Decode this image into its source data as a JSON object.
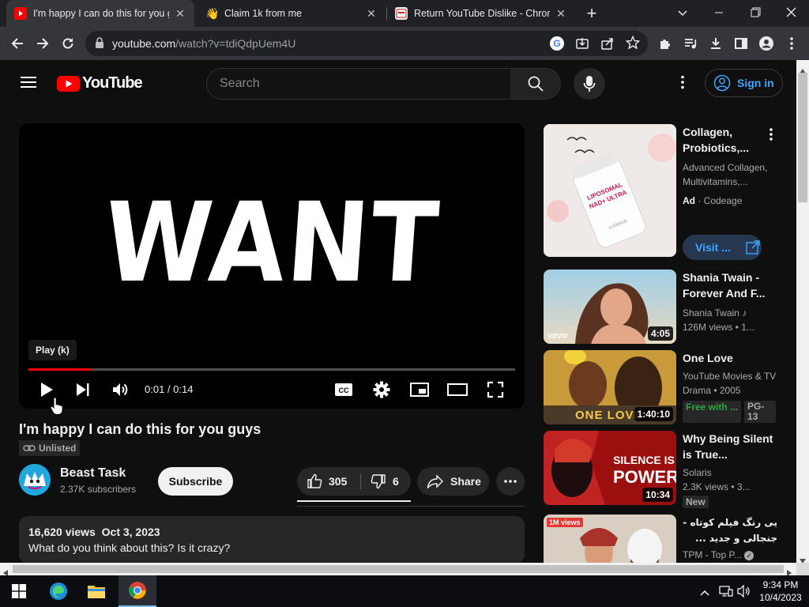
{
  "browser": {
    "tabs": [
      {
        "title": "I'm happy I can do this for you g",
        "active": true
      },
      {
        "title": "Claim 1k from me",
        "active": false
      },
      {
        "title": "Return YouTube Dislike - Chrom",
        "active": false
      }
    ],
    "new_tab": "+",
    "url_host": "youtube.com",
    "url_path": "/watch?v=tdiQdpUem4U"
  },
  "header": {
    "logo_text": "YouTube",
    "search_placeholder": "Search",
    "sign_in": "Sign in"
  },
  "player": {
    "overlay_text": "WANT",
    "tooltip": "Play (k)",
    "time": "0:01 / 0:14",
    "progress_fraction": 0.13
  },
  "video": {
    "title": "I'm happy I can do this for you guys",
    "visibility": "Unlisted",
    "channel": "Beast Task",
    "subscribers": "2.37K subscribers",
    "subscribe": "Subscribe",
    "likes": "305",
    "dislikes": "6",
    "share": "Share",
    "description": {
      "views": "16,620 views",
      "date": "Oct 3, 2023",
      "line1": "What do you think about this? Is it crazy?"
    }
  },
  "sidebar": [
    {
      "title": "Collagen, Probiotics,...",
      "meta1": "Advanced Collagen, Multivitamins,...",
      "ad_label": "Ad",
      "advertiser": "Codeage",
      "cta": "Visit ..."
    },
    {
      "title": "Shania Twain - Forever And F...",
      "channel": "Shania Twain",
      "stats": "126M views  •  1...",
      "duration": "4:05",
      "thumb_text": "vevo"
    },
    {
      "title": "One Love",
      "channel": "YouTube Movies & TV",
      "stats": "Drama • 2005",
      "duration": "1:40:10",
      "free": "Free with ...",
      "rating": "PG-13",
      "thumb_text": "ONE LOVE"
    },
    {
      "title": "Why Being Silent is True...",
      "channel": "Solaris",
      "stats": "2.3K views  •  3...",
      "duration": "10:34",
      "badge": "New",
      "thumb_text1": "SILENCE IS",
      "thumb_text2": "POWER"
    },
    {
      "title": "یی رنگ فیلم کوتاه - جنجالی و جدید ...",
      "channel": "TPM - Top P...",
      "thumb_text": "1M views"
    }
  ],
  "taskbar": {
    "time": "9:34 PM",
    "date": "10/4/2023"
  },
  "colors": {
    "youtube_red": "#ff0000",
    "link_blue": "#3ea6ff",
    "free_green": "#2ba640"
  }
}
